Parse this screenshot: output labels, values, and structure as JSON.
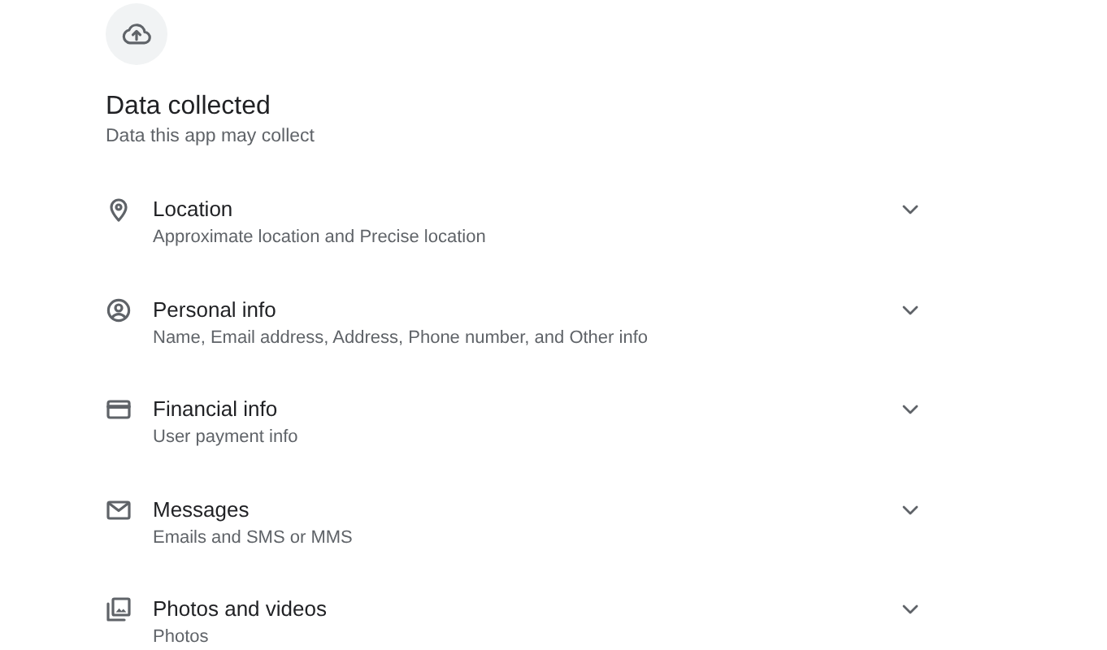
{
  "header": {
    "title": "Data collected",
    "subtitle": "Data this app may collect"
  },
  "items": [
    {
      "kind": "location",
      "title": "Location",
      "detail": "Approximate location and Precise location",
      "expanded": false
    },
    {
      "kind": "person",
      "title": "Personal info",
      "detail": "Name, Email address, Address, Phone number, and Other info",
      "expanded": false
    },
    {
      "kind": "card",
      "title": "Financial info",
      "detail": "User payment info",
      "expanded": false
    },
    {
      "kind": "mail",
      "title": "Messages",
      "detail": "Emails and SMS or MMS",
      "expanded": false
    },
    {
      "kind": "photos",
      "title": "Photos and videos",
      "detail": "Photos",
      "expanded": false
    }
  ]
}
